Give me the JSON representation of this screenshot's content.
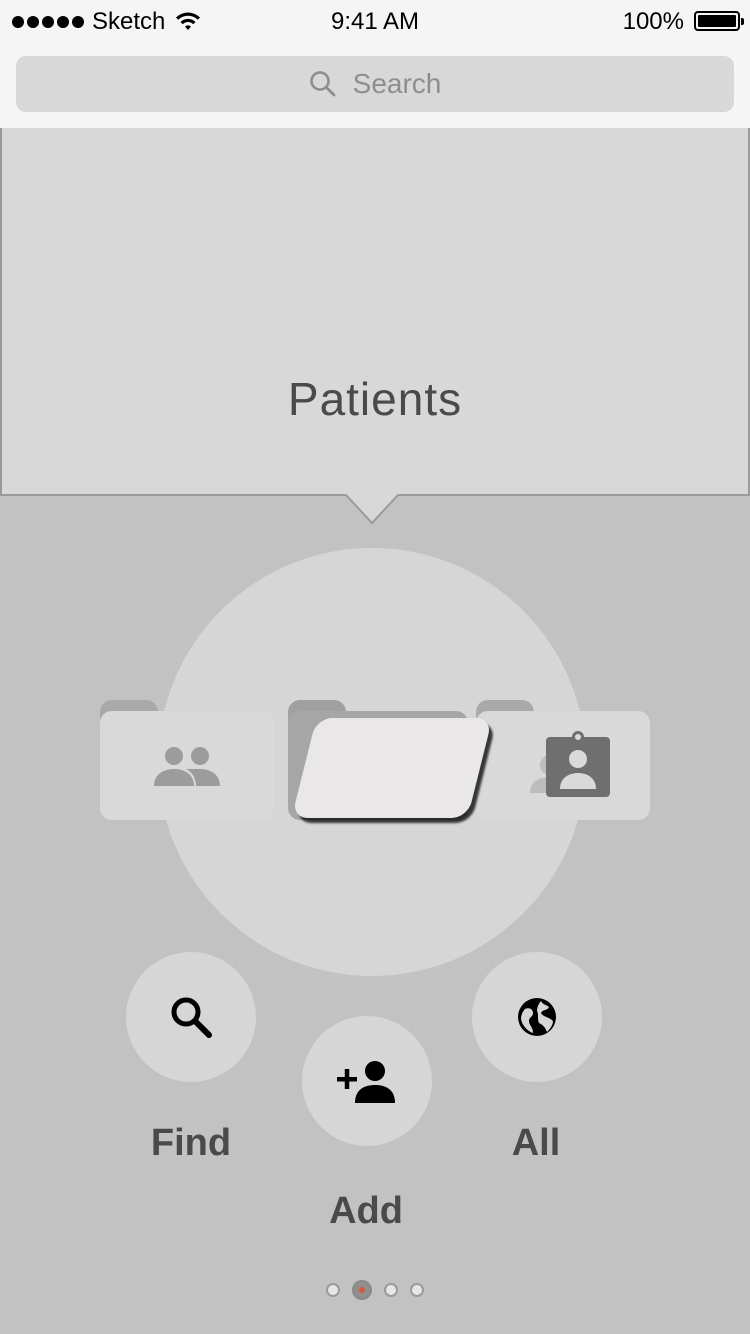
{
  "status_bar": {
    "carrier": "Sketch",
    "time": "9:41 AM",
    "battery_percent": "100%"
  },
  "search": {
    "placeholder": "Search"
  },
  "hero": {
    "title": "Patients"
  },
  "cards": {
    "left_icon": "people-icon",
    "middle_icon": "folder-icon",
    "right_icon": "contact-badge-icon"
  },
  "actions": [
    {
      "label": "Find",
      "icon": "search-icon"
    },
    {
      "label": "Add",
      "icon": "add-person-icon"
    },
    {
      "label": "All",
      "icon": "globe-icon"
    }
  ],
  "pager": {
    "count": 4,
    "active_index": 1,
    "active_color": "#e2572a"
  },
  "colors": {
    "background": "#c2c2c2",
    "panel": "#d8d8d8",
    "text": "#4a4a4a"
  }
}
